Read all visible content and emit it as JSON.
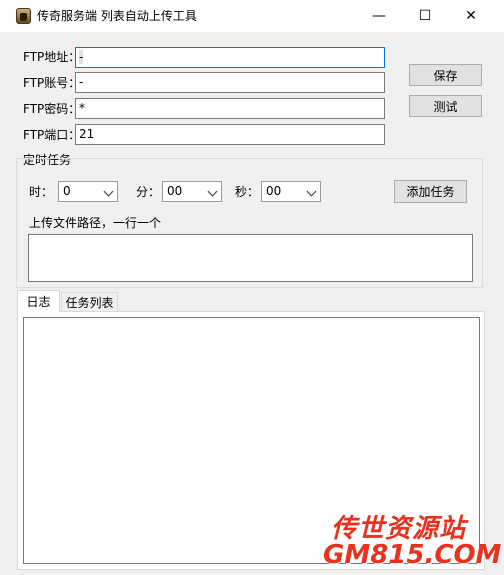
{
  "window": {
    "title": "传奇服务端 列表自动上传工具",
    "minimize_glyph": "—",
    "maximize_glyph": "☐",
    "close_glyph": "✕"
  },
  "ftp": {
    "address_label": "FTP地址：",
    "address_value": "-",
    "account_label": "FTP账号：",
    "account_value": "-",
    "password_label": "FTP密码：",
    "password_value": "*",
    "port_label": "FTP端口：",
    "port_value": "21"
  },
  "buttons": {
    "save": "保存",
    "test": "测试",
    "add_task": "添加任务"
  },
  "scheduled": {
    "group_label": "定时任务",
    "hour_label": "时：",
    "hour_value": "0",
    "minute_label": "分：",
    "minute_value": "00",
    "second_label": "秒：",
    "second_value": "00",
    "path_label": "上传文件路径，一行一个",
    "path_value": ""
  },
  "tabs": [
    {
      "label": "日志",
      "active": true
    },
    {
      "label": "任务列表",
      "active": false
    }
  ],
  "log": {
    "content": ""
  },
  "watermark": {
    "line1": "传世资源站",
    "line2": "GM815.COM"
  },
  "colors": {
    "focus_border": "#0078d7",
    "watermark": "#e8321f"
  }
}
